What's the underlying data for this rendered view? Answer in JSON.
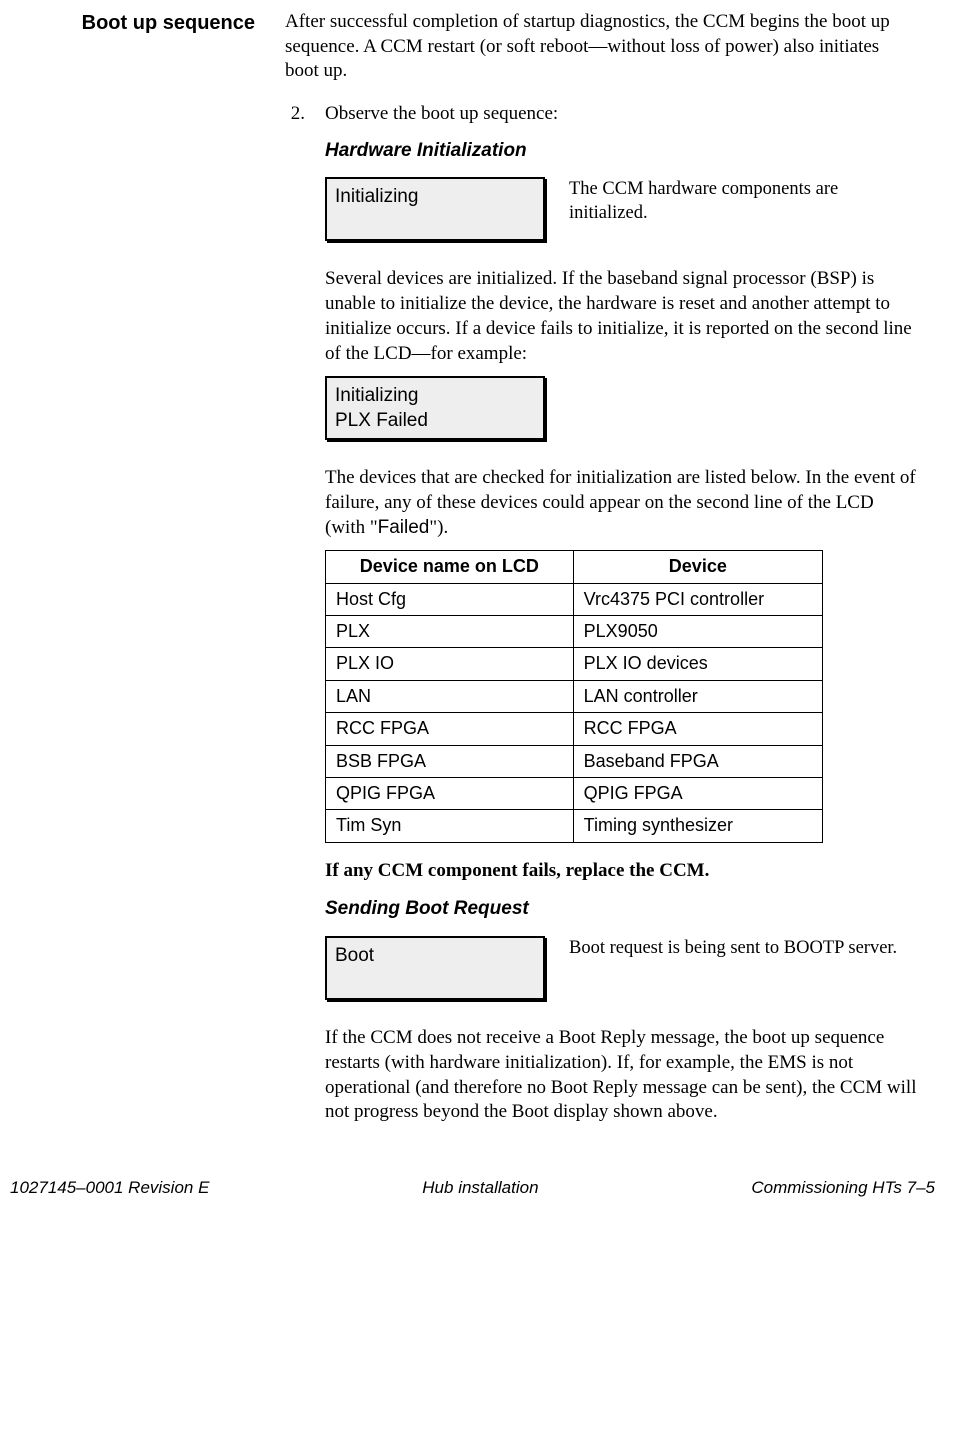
{
  "sideHeading": "Boot up sequence",
  "introPara": "After successful completion of startup diagnostics, the CCM begins the boot up sequence. A CCM restart (or soft reboot—without loss of power) also initiates boot up.",
  "step": {
    "num": "2.",
    "text": "Observe the boot up sequence:"
  },
  "hw": {
    "title": "Hardware Initialization",
    "lcd1": "Initializing",
    "lcd1Caption": "The CCM hardware components are initialized.",
    "para2": "Several devices are initialized. If the baseband signal processor (BSP) is unable to initialize the device, the hardware is reset and another attempt to initialize occurs. If a device fails to initialize, it is reported on the second line of the LCD—for example:",
    "lcd2line1": "Initializing",
    "lcd2line2": "PLX Failed",
    "para3a": "The devices that are checked for initialization are listed below. In the event of failure, any of these devices could appear on the second line of the LCD (with \"",
    "failedWord": "Failed",
    "para3b": "\")."
  },
  "table": {
    "head": {
      "c1": "Device name on LCD",
      "c2": "Device"
    },
    "rows": [
      {
        "c1": "Host Cfg",
        "c2": "Vrc4375 PCI controller"
      },
      {
        "c1": "PLX",
        "c2": "PLX9050"
      },
      {
        "c1": "PLX IO",
        "c2": "PLX IO devices"
      },
      {
        "c1": "LAN",
        "c2": "LAN controller"
      },
      {
        "c1": "RCC FPGA",
        "c2": "RCC FPGA"
      },
      {
        "c1": "BSB FPGA",
        "c2": "Baseband FPGA"
      },
      {
        "c1": "QPIG FPGA",
        "c2": "QPIG FPGA"
      },
      {
        "c1": "Tim Syn",
        "c2": "Timing synthesizer"
      }
    ]
  },
  "replacePara": "If any CCM component fails, replace the CCM.",
  "boot": {
    "title": "Sending Boot Request",
    "lcd": "Boot",
    "lcdCaption": "Boot request is being sent to BOOTP server.",
    "para": "If the CCM does not receive a Boot Reply message, the boot up sequence restarts (with hardware initialization). If, for example, the EMS is not operational (and therefore no Boot Reply message can be sent), the CCM will not progress beyond the Boot display shown above."
  },
  "footer": {
    "left": "1027145–0001  Revision E",
    "center": "Hub installation",
    "right": "Commissioning HTs   7–5"
  }
}
